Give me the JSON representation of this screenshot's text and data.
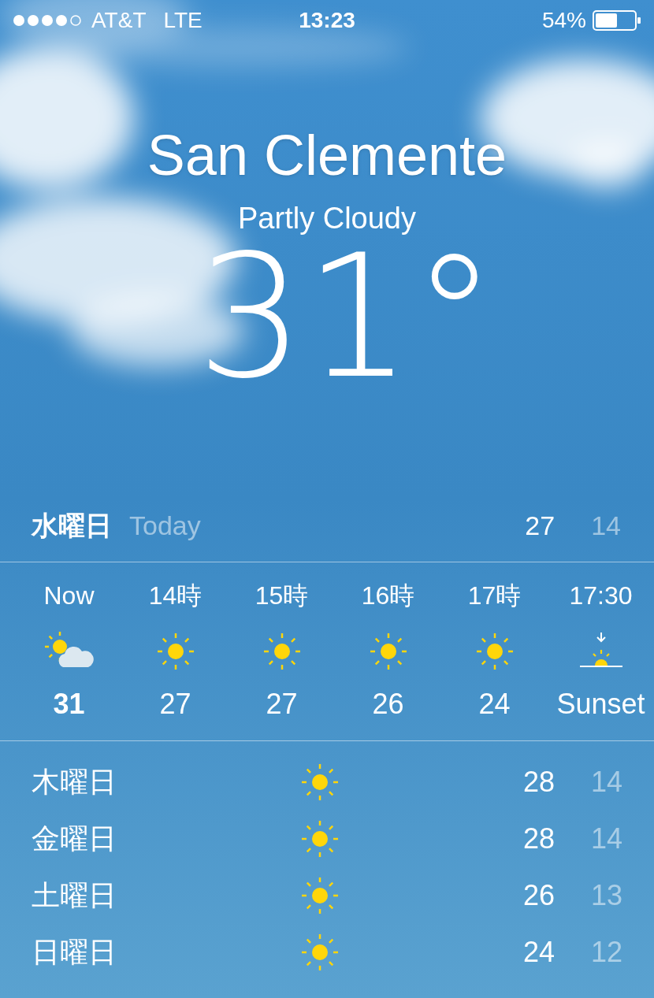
{
  "status_bar": {
    "carrier": "AT&T",
    "network": "LTE",
    "time": "13:23",
    "battery_percent": "54%"
  },
  "location": {
    "city": "San Clemente",
    "condition": "Partly Cloudy",
    "temperature": "31°"
  },
  "today": {
    "day": "水曜日",
    "label": "Today",
    "high": "27",
    "low": "14"
  },
  "hourly": [
    {
      "time": "Now",
      "kind": "partly_cloudy",
      "value": "31",
      "current": true
    },
    {
      "time": "14時",
      "kind": "sunny",
      "value": "27",
      "current": false
    },
    {
      "time": "15時",
      "kind": "sunny",
      "value": "27",
      "current": false
    },
    {
      "time": "16時",
      "kind": "sunny",
      "value": "26",
      "current": false
    },
    {
      "time": "17時",
      "kind": "sunny",
      "value": "24",
      "current": false
    },
    {
      "time": "17:30",
      "kind": "sunset",
      "value": "Sunset",
      "current": false
    }
  ],
  "daily": [
    {
      "day": "木曜日",
      "kind": "sunny",
      "high": "28",
      "low": "14"
    },
    {
      "day": "金曜日",
      "kind": "sunny",
      "high": "28",
      "low": "14"
    },
    {
      "day": "土曜日",
      "kind": "sunny",
      "high": "26",
      "low": "13"
    },
    {
      "day": "日曜日",
      "kind": "sunny",
      "high": "24",
      "low": "12"
    }
  ]
}
